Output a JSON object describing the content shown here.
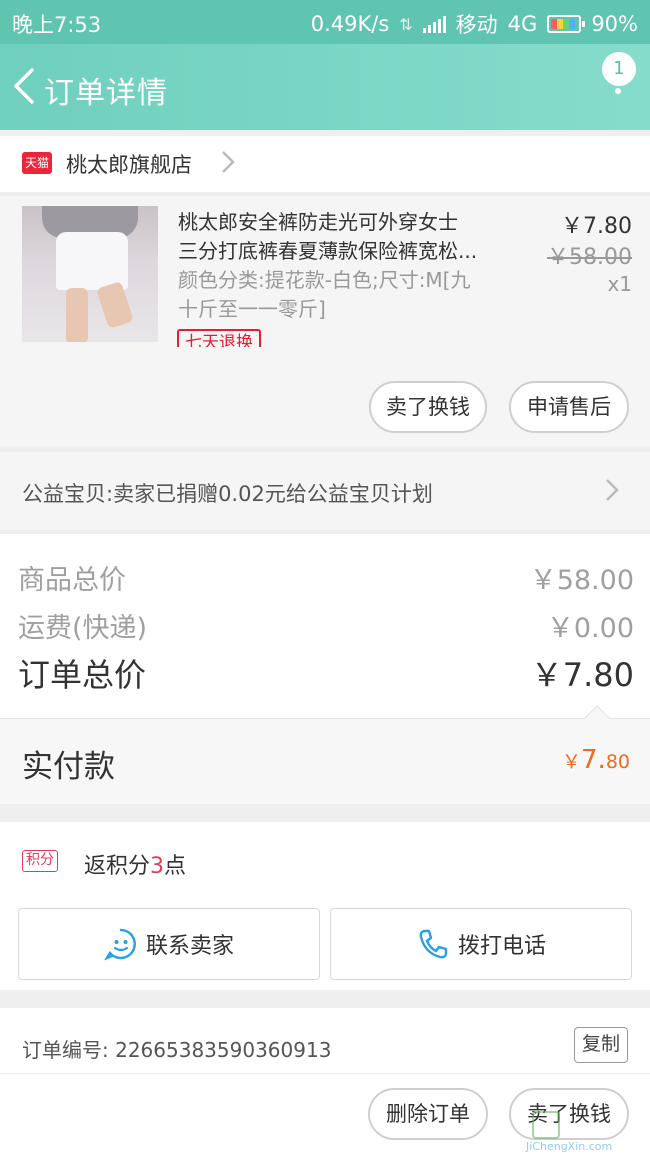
{
  "status_bar": {
    "time": "晚上7:53",
    "speed": "0.49K/s",
    "carrier": "移动",
    "network": "4G",
    "battery": "90%"
  },
  "header": {
    "title": "订单详情",
    "badge_count": "1"
  },
  "shop": {
    "badge": "天猫",
    "name": "桃太郎旗舰店"
  },
  "product": {
    "title_line1": "桃太郎安全裤防走光可外穿女士",
    "title_line2": "三分打底裤春夏薄款保险裤宽松...",
    "sku_line1": "颜色分类:提花款-白色;尺寸:M[九",
    "sku_line2": "十斤至一一零斤]",
    "tag": "七天退换",
    "price": "￥7.80",
    "original_price": "￥58.00",
    "quantity": "x1",
    "sell_button": "卖了换钱",
    "aftersale_button": "申请售后"
  },
  "charity": {
    "text": "公益宝贝:卖家已捐赠0.02元给公益宝贝计划"
  },
  "summary": {
    "goods_total_label": "商品总价",
    "goods_total": "￥58.00",
    "shipping_label": "运费(快递)",
    "shipping": "￥0.00",
    "order_total_label": "订单总价",
    "order_total": "￥7.80",
    "paid_label": "实付款",
    "paid_currency": "￥",
    "paid_integer": "7.",
    "paid_decimal": "80"
  },
  "points": {
    "badge": "积分",
    "text_prefix": "返积分",
    "value": "3",
    "text_suffix": "点"
  },
  "contact": {
    "seller_button": "联系卖家",
    "call_button": "拨打电话"
  },
  "order": {
    "number_label": "订单编号: ",
    "number": "2266538359036091​3",
    "copy_button": "复制"
  },
  "footer": {
    "delete_button": "删除订单",
    "sell_button": "卖了换钱"
  },
  "watermark": {
    "text": "JiChengXin.com"
  },
  "colors": {
    "header_bg": "#6fd0bd",
    "status_bg": "#5fc4b0",
    "price_accent": "#f06a1d",
    "points_accent": "#e23c5b",
    "tmall_red": "#e8273b"
  }
}
